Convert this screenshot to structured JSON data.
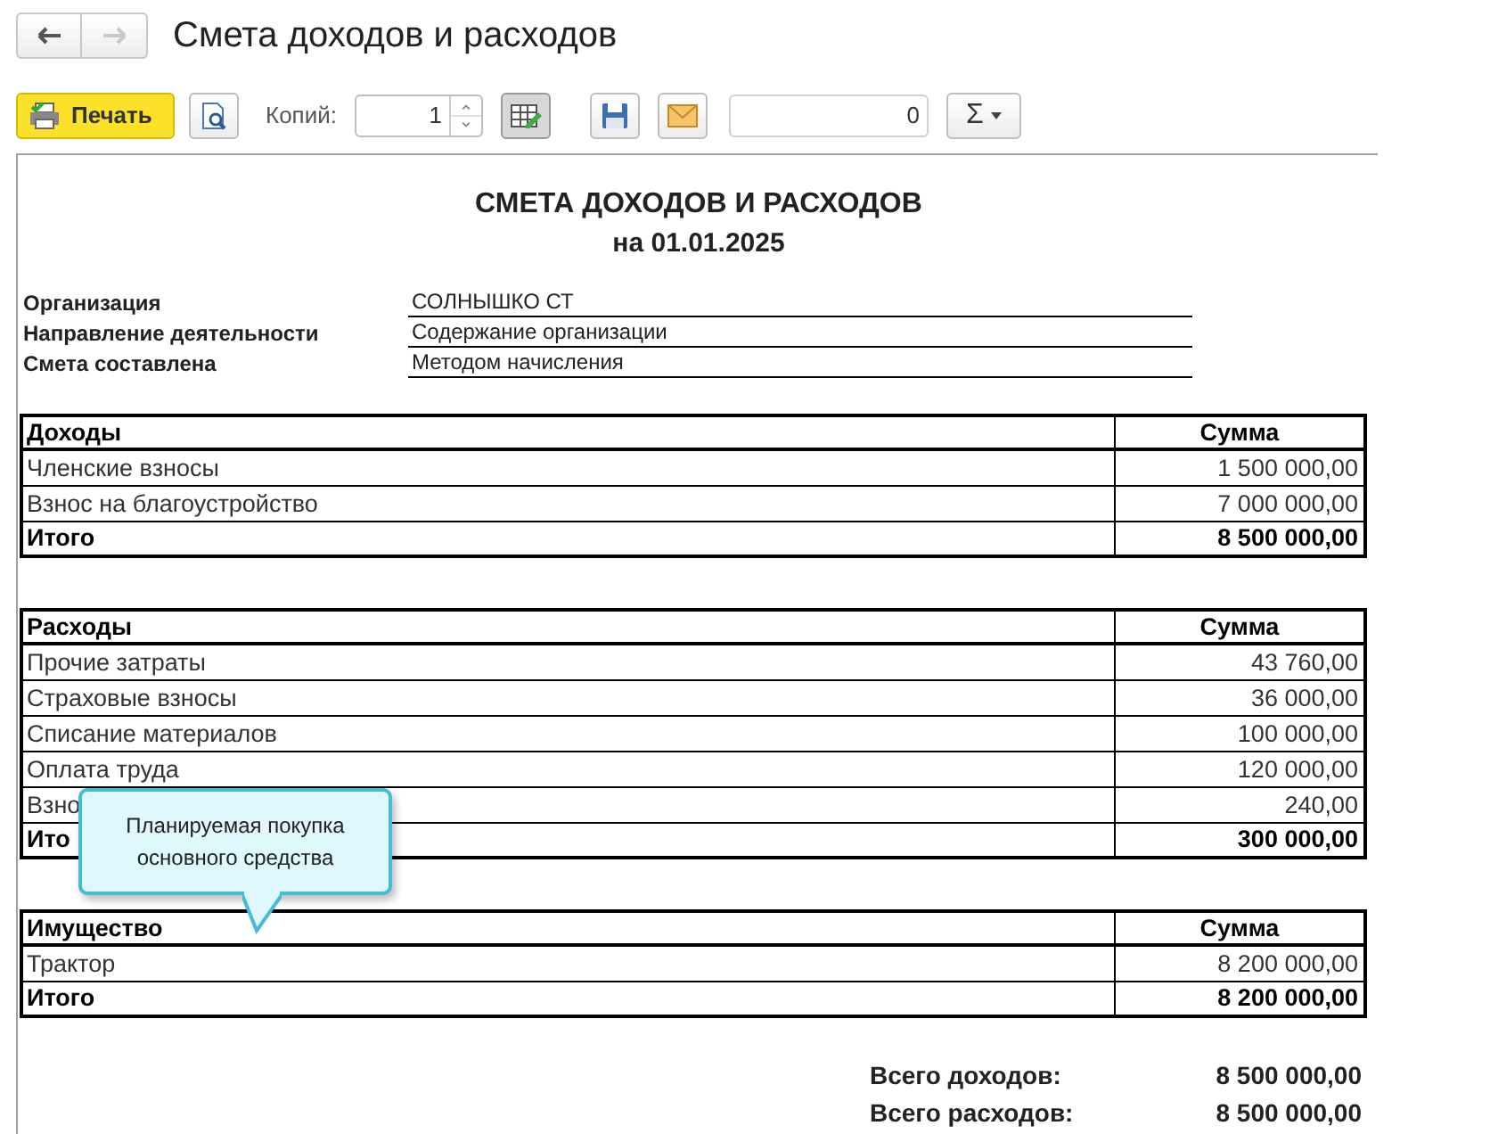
{
  "window": {
    "title": "Смета доходов и расходов",
    "nav": [
      {
        "kind": "back",
        "disabled": false
      },
      {
        "kind": "forward",
        "disabled": true
      }
    ]
  },
  "toolbar": {
    "print": "Печать",
    "copies_label": "Копий:",
    "copies": "1",
    "edit_pressed": true,
    "sum_field": "0",
    "sum_button": "Σ"
  },
  "report": {
    "title": "СМЕТА ДОХОДОВ И РАСХОДОВ",
    "subtitle": "на 01.01.2025",
    "info": [
      {
        "label": "Организация",
        "value": "СОЛНЫШКО СТ"
      },
      {
        "label": "Направление деятельности",
        "value": "Содержание организации"
      },
      {
        "label": "Смета составлена",
        "value": "Методом начисления"
      }
    ],
    "sections": [
      {
        "heading": "Доходы",
        "sum_heading": "Сумма",
        "rows": [
          {
            "name": "Членские взносы",
            "amount": "1 500 000,00"
          },
          {
            "name": "Взнос на благоустройство",
            "amount": "7 000 000,00"
          }
        ],
        "total": {
          "label": "Итого",
          "amount": "8 500 000,00"
        }
      },
      {
        "heading": "Расходы",
        "sum_heading": "Сумма",
        "rows": [
          {
            "name": "Прочие затраты",
            "amount": "43 760,00"
          },
          {
            "name": "Страховые взносы",
            "amount": "36 000,00"
          },
          {
            "name": "Списание материалов",
            "amount": "100 000,00"
          },
          {
            "name": "Оплата труда",
            "amount": "120 000,00"
          },
          {
            "name": "Взно",
            "amount": "240,00"
          }
        ],
        "total": {
          "label": "Ито",
          "amount": "300 000,00"
        }
      },
      {
        "heading": "Имущество",
        "sum_heading": "Сумма",
        "rows": [
          {
            "name": "Трактор",
            "amount": "8 200 000,00"
          }
        ],
        "total": {
          "label": "Итого",
          "amount": "8 200 000,00"
        }
      }
    ],
    "summary": [
      {
        "label": "Всего доходов:",
        "amount": "8 500 000,00"
      },
      {
        "label": "Всего расходов:",
        "amount": "8 500 000,00"
      }
    ]
  },
  "tooltip": "Планируемая покупка основного средства"
}
